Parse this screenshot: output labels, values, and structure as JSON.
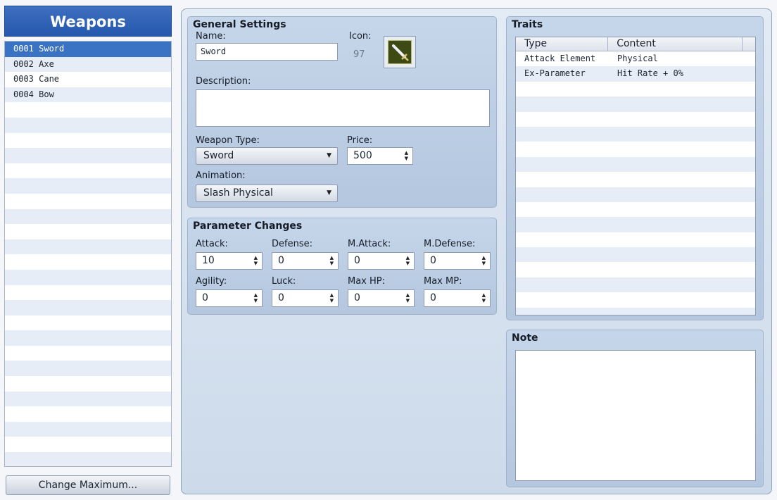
{
  "weapons_header": "Weapons",
  "weapon_list": [
    {
      "label": "0001 Sword"
    },
    {
      "label": "0002 Axe"
    },
    {
      "label": "0003 Cane"
    },
    {
      "label": "0004 Bow"
    }
  ],
  "change_max_label": "Change Maximum...",
  "general": {
    "title": "General Settings",
    "name_label": "Name:",
    "name_value": "Sword",
    "icon_label": "Icon:",
    "icon_index": "97",
    "icon_name": "sword-icon",
    "description_label": "Description:",
    "description_value": "",
    "weapon_type_label": "Weapon Type:",
    "weapon_type_value": "Sword",
    "price_label": "Price:",
    "price_value": "500",
    "animation_label": "Animation:",
    "animation_value": "Slash Physical"
  },
  "params": {
    "title": "Parameter Changes",
    "attack_label": "Attack:",
    "attack_value": "10",
    "defense_label": "Defense:",
    "defense_value": "0",
    "mattack_label": "M.Attack:",
    "mattack_value": "0",
    "mdefense_label": "M.Defense:",
    "mdefense_value": "0",
    "agility_label": "Agility:",
    "agility_value": "0",
    "luck_label": "Luck:",
    "luck_value": "0",
    "maxhp_label": "Max HP:",
    "maxhp_value": "0",
    "maxmp_label": "Max MP:",
    "maxmp_value": "0"
  },
  "traits": {
    "title": "Traits",
    "col_type": "Type",
    "col_content": "Content",
    "rows": [
      {
        "type": "Attack Element",
        "content": "Physical"
      },
      {
        "type": "Ex-Parameter",
        "content": "Hit Rate + 0%"
      }
    ]
  },
  "note": {
    "title": "Note",
    "value": ""
  },
  "colors": {
    "header_blue": "#2558ae",
    "selection_blue": "#3b73c4"
  }
}
